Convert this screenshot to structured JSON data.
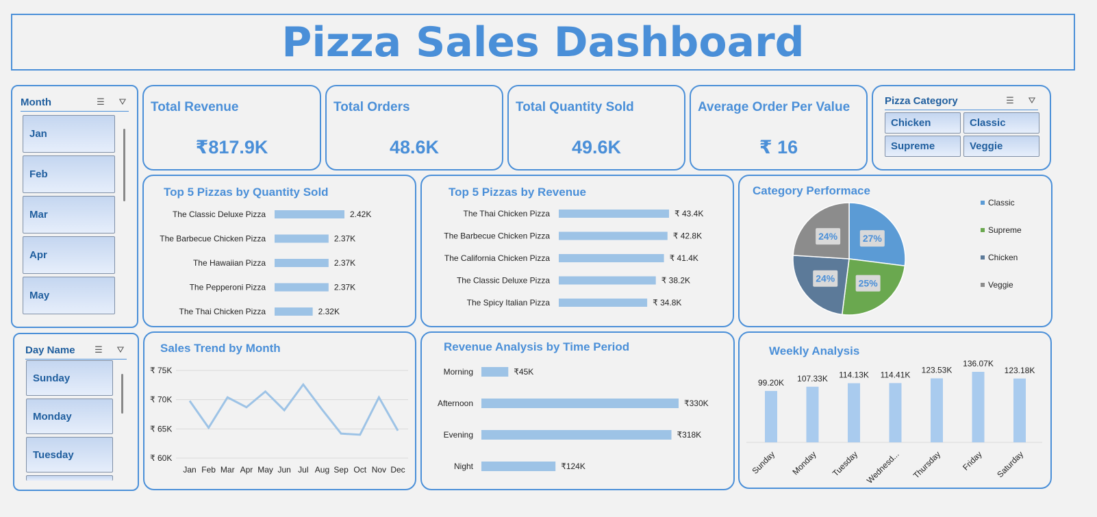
{
  "title": "Pizza Sales Dashboard",
  "month_slicer": {
    "title": "Month",
    "items": [
      "Jan",
      "Feb",
      "Mar",
      "Apr",
      "May"
    ]
  },
  "day_slicer": {
    "title": "Day Name",
    "items": [
      "Sunday",
      "Monday",
      "Tuesday"
    ]
  },
  "kpis": [
    {
      "label": "Total Revenue",
      "value": "₹817.9K"
    },
    {
      "label": "Total Orders",
      "value": "48.6K"
    },
    {
      "label": "Total Quantity Sold",
      "value": "49.6K"
    },
    {
      "label": "Average Order Per Value",
      "value": "₹ 16"
    }
  ],
  "category_slicer": {
    "title": "Pizza Category",
    "items": [
      "Chicken",
      "Classic",
      "Supreme",
      "Veggie"
    ]
  },
  "colors": {
    "accent": "#4a8fd8",
    "bar": "#9dc3e6",
    "classic": "#5b9bd5",
    "supreme": "#6aa84f",
    "chicken": "#5c7a99",
    "veggie": "#8c8c8c"
  },
  "chart_data": [
    {
      "type": "bar",
      "title": "Top 5 Pizzas by Quantity Sold",
      "categories": [
        "The Classic Deluxe Pizza",
        "The Barbecue Chicken Pizza",
        "The Hawaiian Pizza",
        "The Pepperoni Pizza",
        "The Thai Chicken Pizza"
      ],
      "values": [
        2.42,
        2.37,
        2.37,
        2.37,
        2.32
      ],
      "labels": [
        "2.42K",
        "2.37K",
        "2.37K",
        "2.37K",
        "2.32K"
      ]
    },
    {
      "type": "bar",
      "title": "Top 5 Pizzas by Revenue",
      "categories": [
        "The Thai Chicken Pizza",
        "The Barbecue Chicken Pizza",
        "The California Chicken Pizza",
        "The Classic Deluxe Pizza",
        "The Spicy Italian Pizza"
      ],
      "values": [
        43.4,
        42.8,
        41.4,
        38.2,
        34.8
      ],
      "labels": [
        "₹ 43.4K",
        "₹ 42.8K",
        "₹ 41.4K",
        "₹ 38.2K",
        "₹ 34.8K"
      ]
    },
    {
      "type": "pie",
      "title": "Category Performace",
      "categories": [
        "Classic",
        "Supreme",
        "Chicken",
        "Veggie"
      ],
      "values": [
        27,
        25,
        24,
        24
      ],
      "labels": [
        "27%",
        "25%",
        "24%",
        "24%"
      ]
    },
    {
      "type": "line",
      "title": "Sales Trend by Month",
      "categories": [
        "Jan",
        "Feb",
        "Mar",
        "Apr",
        "May",
        "Jun",
        "Jul",
        "Aug",
        "Sep",
        "Oct",
        "Nov",
        "Dec"
      ],
      "values": [
        69.8,
        65.2,
        70.4,
        68.7,
        71.4,
        68.2,
        72.6,
        68.3,
        64.2,
        64.0,
        70.4,
        64.7
      ],
      "ylim": [
        60,
        75
      ],
      "yticks": [
        "₹ 75K",
        "₹ 70K",
        "₹ 65K",
        "₹ 60K"
      ]
    },
    {
      "type": "bar",
      "title": "Revenue Analysis by Time Period",
      "categories": [
        "Morning",
        "Afternoon",
        "Evening",
        "Night"
      ],
      "values": [
        45,
        330,
        318,
        124
      ],
      "labels": [
        "₹45K",
        "₹330K",
        "₹318K",
        "₹124K"
      ]
    },
    {
      "type": "bar",
      "title": "Weekly Analysis",
      "categories": [
        "Sunday",
        "Monday",
        "Tuesday",
        "Wednesd...",
        "Thursday",
        "Friday",
        "Saturday"
      ],
      "values": [
        99.2,
        107.33,
        114.13,
        114.41,
        123.53,
        136.07,
        123.18
      ],
      "labels": [
        "99.20K",
        "107.33K",
        "114.13K",
        "114.41K",
        "123.53K",
        "136.07K",
        "123.18K"
      ]
    }
  ]
}
